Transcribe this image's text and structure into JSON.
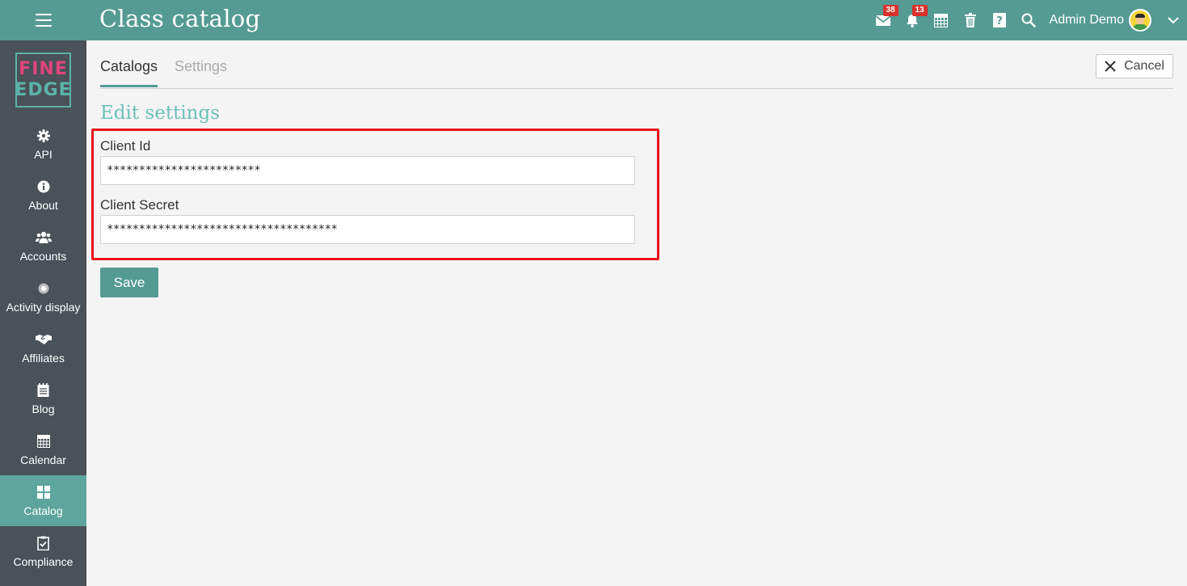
{
  "header": {
    "title": "Class catalog",
    "messages_badge": "38",
    "notifications_badge": "13",
    "user_name": "Admin Demo",
    "icons": [
      "menu-icon",
      "mail-icon",
      "bell-icon",
      "calendar-grid-icon",
      "trash-icon",
      "help-icon",
      "search-icon",
      "chevron-down-icon"
    ]
  },
  "logo": {
    "line1": "FINE",
    "line2": "EDGE"
  },
  "sidebar": {
    "items": [
      {
        "label": "API",
        "icon": "gear-icon"
      },
      {
        "label": "About",
        "icon": "info-icon"
      },
      {
        "label": "Accounts",
        "icon": "users-icon"
      },
      {
        "label": "Activity display",
        "icon": "dot-circle-icon"
      },
      {
        "label": "Affiliates",
        "icon": "handshake-icon"
      },
      {
        "label": "Blog",
        "icon": "notepad-icon"
      },
      {
        "label": "Calendar",
        "icon": "calendar-icon"
      },
      {
        "label": "Catalog",
        "icon": "grid-icon",
        "active": true
      },
      {
        "label": "Compliance",
        "icon": "clipboard-check-icon"
      }
    ]
  },
  "tabs": [
    {
      "label": "Catalogs",
      "active": true
    },
    {
      "label": "Settings",
      "active": false
    }
  ],
  "cancel_label": "Cancel",
  "form": {
    "title": "Edit settings",
    "client_id_label": "Client Id",
    "client_id_value": "************************",
    "client_secret_label": "Client Secret",
    "client_secret_value": "************************************",
    "save_label": "Save"
  },
  "colors": {
    "header": "#559b94",
    "sidebar": "#4a5158",
    "sidebar_active": "#5ea59e",
    "accent_title": "#6cc0b6",
    "highlight_border": "#e8111b",
    "badge": "#d9322b"
  }
}
